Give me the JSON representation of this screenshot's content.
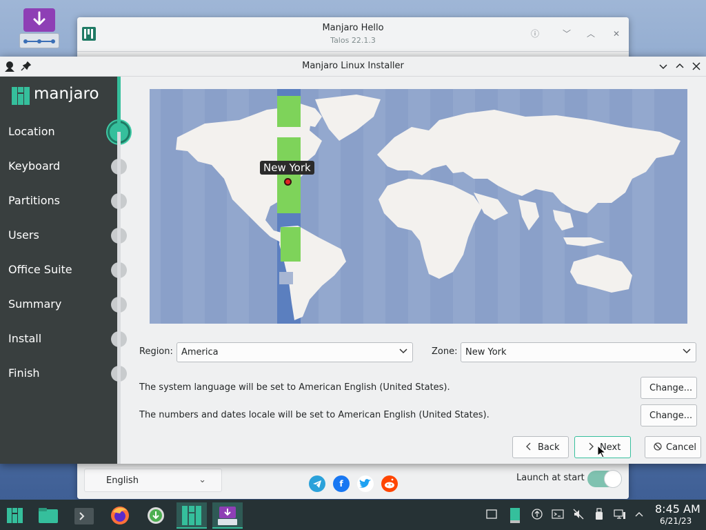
{
  "hello_window": {
    "title": "Manjaro Hello",
    "subtitle": "Talos 22.1.3",
    "language_value": "English",
    "launch_label": "Launch at start",
    "launch_enabled": true,
    "social": [
      {
        "icon": "telegram-icon",
        "color": "#2aa1da"
      },
      {
        "icon": "facebook-icon",
        "color": "#1877f2"
      },
      {
        "icon": "twitter-icon",
        "color": "#1da1f2"
      },
      {
        "icon": "reddit-icon",
        "color": "#ff4500"
      }
    ]
  },
  "installer": {
    "title": "Manjaro Linux Installer",
    "brand": "manjaro",
    "steps": [
      {
        "label": "Location",
        "active": true
      },
      {
        "label": "Keyboard",
        "active": false
      },
      {
        "label": "Partitions",
        "active": false
      },
      {
        "label": "Users",
        "active": false
      },
      {
        "label": "Office Suite",
        "active": false
      },
      {
        "label": "Summary",
        "active": false
      },
      {
        "label": "Install",
        "active": false
      },
      {
        "label": "Finish",
        "active": false
      }
    ],
    "map": {
      "marker_label": "New York"
    },
    "region_label": "Region:",
    "region_value": "America",
    "zone_label": "Zone:",
    "zone_value": "New York",
    "language_info": "The system language will be set to American English (United States).",
    "locale_info": "The numbers and dates locale will be set to American English (United States).",
    "change_label": "Change...",
    "back_label": "Back",
    "next_label": "Next",
    "cancel_label": "Cancel"
  },
  "taskbar": {
    "time": "8:45 AM",
    "date": "6/21/23"
  },
  "colors": {
    "accent": "#35bf9c",
    "sidebar": "#393f3f",
    "timezone_highlight": "#7ed35a"
  }
}
